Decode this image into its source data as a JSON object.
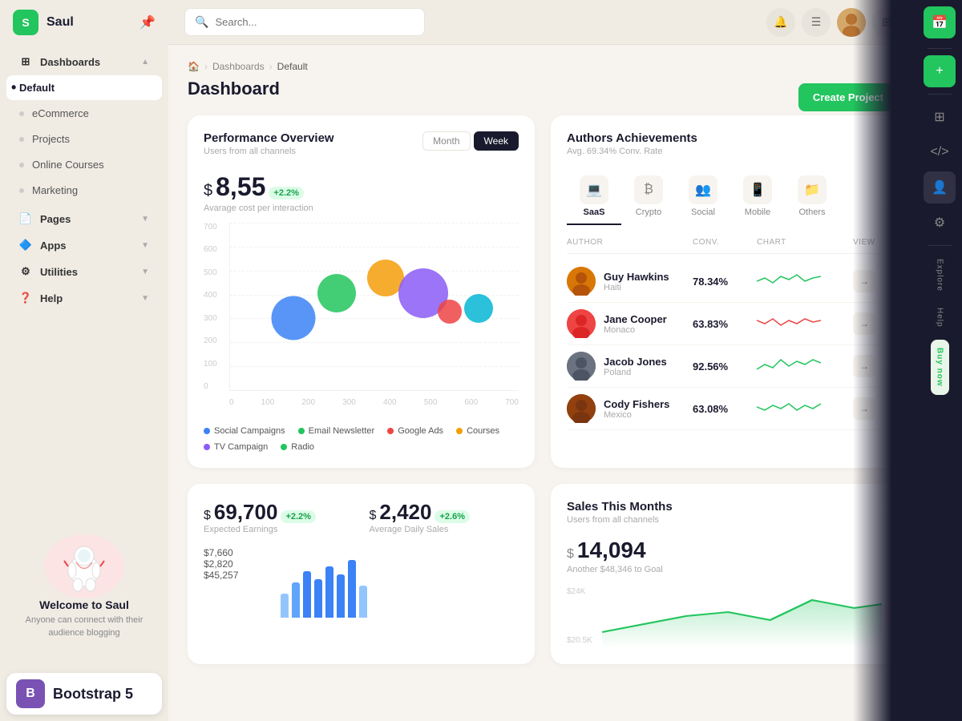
{
  "app": {
    "brand": "Saul",
    "logo_letter": "S"
  },
  "sidebar": {
    "items": [
      {
        "id": "dashboards",
        "label": "Dashboards",
        "icon": "⊞",
        "hasArrow": true,
        "isGroup": true
      },
      {
        "id": "default",
        "label": "Default",
        "active": true
      },
      {
        "id": "ecommerce",
        "label": "eCommerce"
      },
      {
        "id": "projects",
        "label": "Projects"
      },
      {
        "id": "online-courses",
        "label": "Online Courses"
      },
      {
        "id": "marketing",
        "label": "Marketing"
      },
      {
        "id": "pages",
        "label": "Pages",
        "icon": "📄",
        "hasArrow": true,
        "isGroup": true
      },
      {
        "id": "apps",
        "label": "Apps",
        "icon": "🔷",
        "hasArrow": true,
        "isGroup": true
      },
      {
        "id": "utilities",
        "label": "Utilities",
        "icon": "⚙",
        "hasArrow": true,
        "isGroup": true
      },
      {
        "id": "help",
        "label": "Help",
        "icon": "❓",
        "hasArrow": true,
        "isGroup": true
      }
    ],
    "welcome": {
      "title": "Welcome to Saul",
      "text": "Anyone can connect with their audience blogging"
    }
  },
  "topbar": {
    "search_placeholder": "Search..."
  },
  "breadcrumb": {
    "home": "🏠",
    "dashboards": "Dashboards",
    "current": "Default"
  },
  "page": {
    "title": "Dashboard",
    "create_btn": "Create Project"
  },
  "performance": {
    "title": "Performance Overview",
    "subtitle": "Users from all channels",
    "period_month": "Month",
    "period_week": "Week",
    "value": "8,55",
    "badge": "+2.2%",
    "value_label": "Avarage cost per interaction",
    "y_labels": [
      "700",
      "600",
      "500",
      "400",
      "300",
      "200",
      "100",
      "0"
    ],
    "x_labels": [
      "0",
      "100",
      "200",
      "300",
      "400",
      "500",
      "600",
      "700"
    ],
    "bubbles": [
      {
        "x": 22,
        "y": 57,
        "size": 55,
        "color": "#3b82f6"
      },
      {
        "x": 37,
        "y": 42,
        "size": 48,
        "color": "#22c55e"
      },
      {
        "x": 54,
        "y": 33,
        "size": 46,
        "color": "#f59e0b"
      },
      {
        "x": 67,
        "y": 42,
        "size": 62,
        "color": "#8b5cf6"
      },
      {
        "x": 76,
        "y": 53,
        "size": 30,
        "color": "#ef4444"
      },
      {
        "x": 86,
        "y": 51,
        "size": 36,
        "color": "#06b6d4"
      }
    ],
    "legend": [
      {
        "label": "Social Campaigns",
        "color": "#3b82f6"
      },
      {
        "label": "Email Newsletter",
        "color": "#22c55e"
      },
      {
        "label": "Google Ads",
        "color": "#ef4444"
      },
      {
        "label": "Courses",
        "color": "#f59e0b"
      },
      {
        "label": "TV Campaign",
        "color": "#8b5cf6"
      },
      {
        "label": "Radio",
        "color": "#22c55e"
      }
    ]
  },
  "authors": {
    "title": "Authors Achievements",
    "subtitle": "Avg. 69.34% Conv. Rate",
    "tabs": [
      {
        "id": "saas",
        "label": "SaaS",
        "icon": "💻",
        "active": true
      },
      {
        "id": "crypto",
        "label": "Crypto",
        "icon": "₿"
      },
      {
        "id": "social",
        "label": "Social",
        "icon": "👥"
      },
      {
        "id": "mobile",
        "label": "Mobile",
        "icon": "📱"
      },
      {
        "id": "others",
        "label": "Others",
        "icon": "📁"
      }
    ],
    "headers": {
      "author": "AUTHOR",
      "conv": "CONV.",
      "chart": "CHART",
      "view": "VIEW"
    },
    "rows": [
      {
        "name": "Guy Hawkins",
        "country": "Haiti",
        "conv": "78.34%",
        "color": "#d97706",
        "chart_color": "#22c55e"
      },
      {
        "name": "Jane Cooper",
        "country": "Monaco",
        "conv": "63.83%",
        "color": "#ef4444",
        "chart_color": "#ef4444"
      },
      {
        "name": "Jacob Jones",
        "country": "Poland",
        "conv": "92.56%",
        "color": "#6b7280",
        "chart_color": "#22c55e"
      },
      {
        "name": "Cody Fishers",
        "country": "Mexico",
        "conv": "63.08%",
        "color": "#92400e",
        "chart_color": "#22c55e"
      }
    ]
  },
  "earnings": {
    "expected_value": "69,700",
    "expected_badge": "+2.2%",
    "expected_label": "Expected Earnings",
    "daily_value": "2,420",
    "daily_badge": "+2.6%",
    "daily_label": "Average Daily Sales",
    "amounts": [
      "$7,660",
      "$2,820",
      "$45,257"
    ],
    "bars": [
      30,
      50,
      65,
      55,
      70,
      62,
      80,
      45
    ]
  },
  "sales": {
    "title": "Sales This Months",
    "subtitle": "Users from all channels",
    "value": "14,094",
    "goal_text": "Another $48,346 to Goal",
    "y_labels": [
      "$24K",
      "$20.5K"
    ]
  },
  "right_panel": {
    "labels": [
      "Explore",
      "Help",
      "Buy now"
    ]
  },
  "bootstrap": {
    "icon": "B",
    "text": "Bootstrap 5"
  }
}
